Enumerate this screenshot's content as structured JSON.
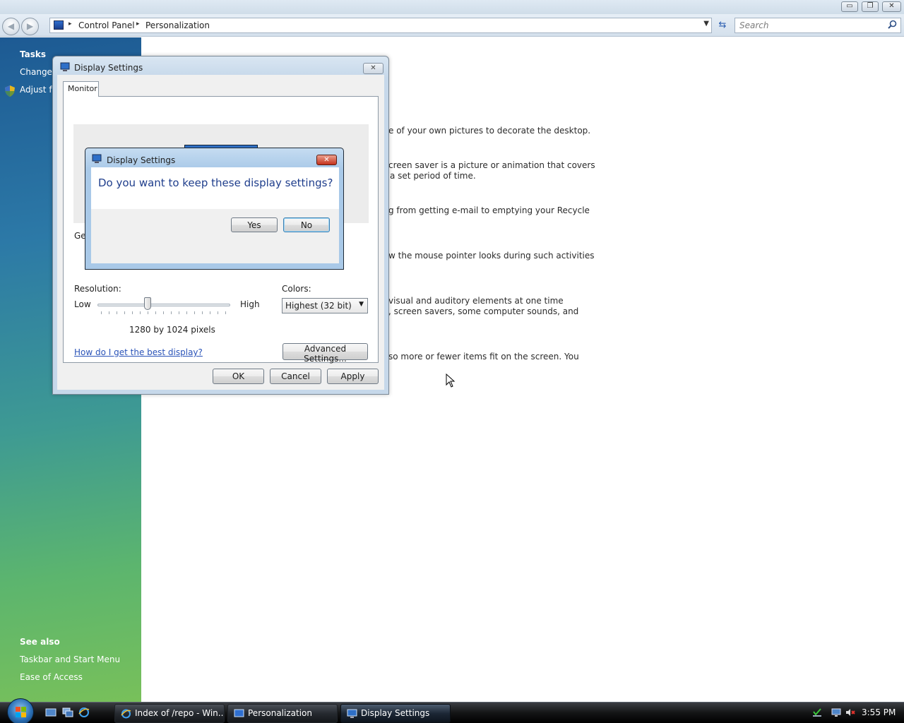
{
  "window": {
    "caption_buttons": {
      "minimize": "▭",
      "restore": "❐",
      "close": "✕"
    }
  },
  "navigation": {
    "back_glyph": "◀",
    "forward_glyph": "▶",
    "breadcrumbs": [
      "Control Panel",
      "Personalization"
    ],
    "search_placeholder": "Search",
    "icons": [
      "back-icon",
      "forward-icon",
      "control-panel-icon",
      "refresh-icon",
      "search-icon"
    ]
  },
  "left_pane": {
    "tasks_heading": "Tasks",
    "tasks": [
      "Change",
      "Adjust fo"
    ],
    "see_also_heading": "See also",
    "see_also": [
      "Taskbar and Start Menu",
      "Ease of Access"
    ]
  },
  "content": {
    "descriptions": [
      "e of your own pictures to decorate the desktop.",
      "creen saver is a picture or animation that covers",
      "a set period of time.",
      "g from getting e-mail to emptying your Recycle",
      "w the mouse pointer looks during such activities",
      "visual and auditory elements at one time",
      ", screen savers, some computer sounds, and",
      "so more or fewer items fit on the screen. You"
    ]
  },
  "display_dialog": {
    "title": "Display Settings",
    "close_glyph": "✕",
    "tab": "Monitor",
    "partial_label": "Ger",
    "resolution_label": "Resolution:",
    "low_label": "Low",
    "high_label": "High",
    "resolution_value": "1280 by 1024 pixels",
    "colors_label": "Colors:",
    "colors_selected": "Highest (32 bit)",
    "help_link": "How do I get the best display?",
    "advanced_button": "Advanced Settings...",
    "ok_button": "OK",
    "cancel_button": "Cancel",
    "apply_button": "Apply"
  },
  "confirm_dialog": {
    "title": "Display Settings",
    "close_glyph": "✕",
    "question": "Do you want to keep these display settings?",
    "yes_button": "Yes",
    "no_button": "No"
  },
  "taskbar": {
    "tasks": [
      "Index of /repo - Win...",
      "Personalization",
      "Display Settings"
    ],
    "active_task": "Display Settings",
    "clock": "3:55 PM"
  },
  "colors": {
    "accent": "#1f3e8c",
    "link": "#2a53b8",
    "confirm_close": "#c4321c",
    "left_pane_top": "#1d5a93",
    "left_pane_bottom": "#78c05a"
  }
}
